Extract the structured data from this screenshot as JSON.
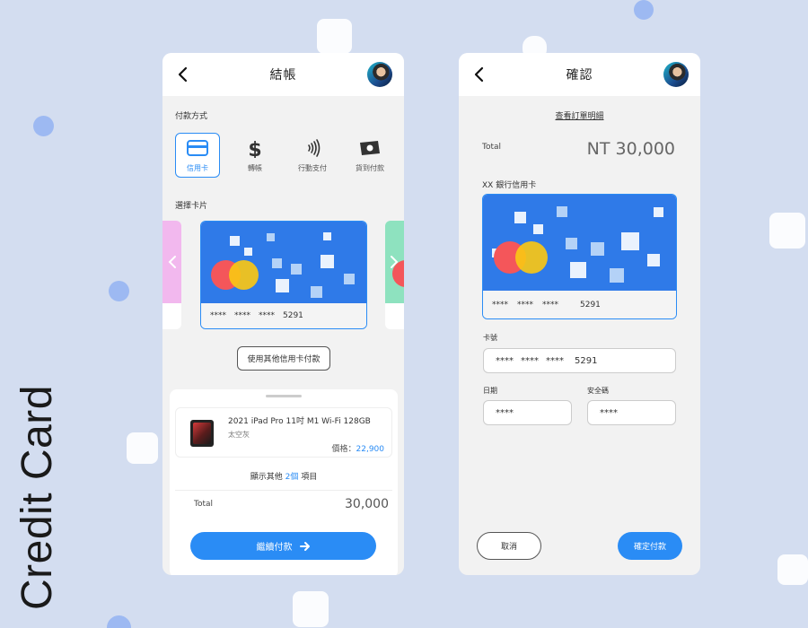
{
  "side_title": "Credit Card",
  "colors": {
    "background": "#d3ddf0",
    "accent": "#2a8cf5",
    "card_blue": "#2f7ae8",
    "decor": "#9db9f2"
  },
  "checkout": {
    "title": "結帳",
    "back_icon": "chevron-left-icon",
    "payment_method_label": "付款方式",
    "methods": [
      {
        "label": "信用卡",
        "icon": "credit-card-icon",
        "active": true
      },
      {
        "label": "轉帳",
        "icon": "dollar-icon",
        "active": false
      },
      {
        "label": "行動支付",
        "icon": "contactless-icon",
        "active": false
      },
      {
        "label": "貨到付款",
        "icon": "cash-icon",
        "active": false
      }
    ],
    "choose_card_label": "選擇卡片",
    "card": {
      "masks": [
        "****",
        "****",
        "****"
      ],
      "last4": "5291"
    },
    "other_card_button": "使用其他信用卡付款",
    "product": {
      "name": "2021 iPad Pro 11吋 M1 Wi-Fi 128GB",
      "variant": "太空灰",
      "price_label": "價格：",
      "price_value": "22,900"
    },
    "more_items": {
      "prefix": "顯示其他",
      "count": "2個",
      "suffix": "項目"
    },
    "total_label": "Total",
    "total_value": "30,000",
    "continue_button": "繼續付款"
  },
  "confirm": {
    "title": "確認",
    "view_order_link": "查看訂單明細",
    "total_label": "Total",
    "total_value": "NT 30,000",
    "bank_label": "XX 銀行信用卡",
    "card": {
      "masks": [
        "****",
        "****",
        "****"
      ],
      "last4": "5291"
    },
    "card_number_label": "卡號",
    "card_number_masks": [
      "****",
      "****",
      "****"
    ],
    "card_number_last4": "5291",
    "date_label": "日期",
    "date_value": "****",
    "cvv_label": "安全碼",
    "cvv_value": "****",
    "cancel_button": "取消",
    "confirm_button": "確定付款"
  }
}
